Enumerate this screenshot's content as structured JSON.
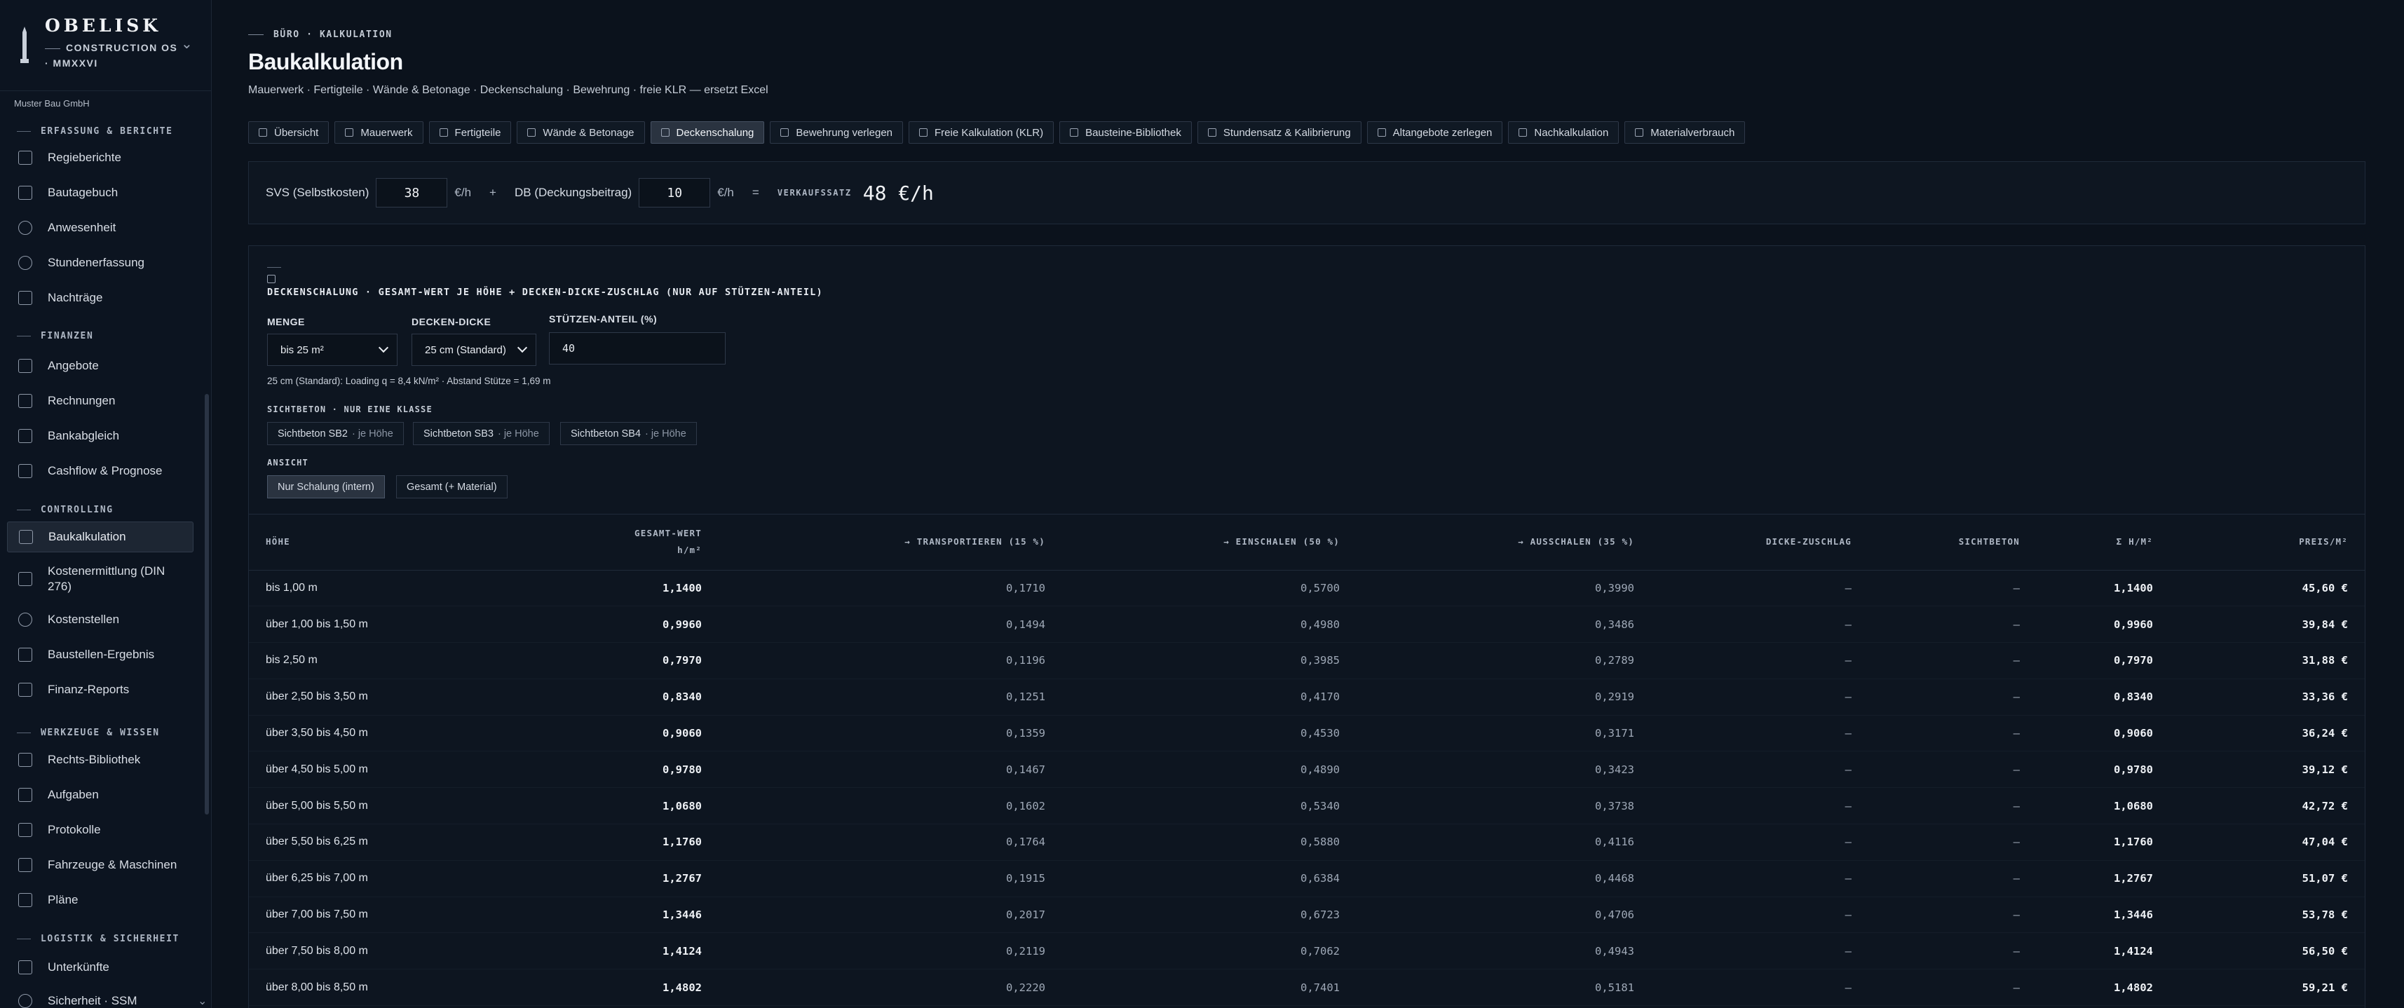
{
  "sidebar": {
    "brand": {
      "name": "OBELISK",
      "line1": "CONSTRUCTION OS",
      "line2": "· MMXXVI"
    },
    "company": "Muster Bau GmbH",
    "groups": {
      "erfassung": "ERFASSUNG & BERICHTE",
      "finanzen": "FINANZEN",
      "controlling": "CONTROLLING",
      "werkzeuge": "WERKZEUGE & WISSEN",
      "logistik": "LOGISTIK & SICHERHEIT"
    },
    "items": {
      "regieberichte": "Regieberichte",
      "bautagebuch": "Bautagebuch",
      "anwesenheit": "Anwesenheit",
      "stundenerfassung": "Stundenerfassung",
      "nachtraege": "Nachträge",
      "angebote": "Angebote",
      "rechnungen": "Rechnungen",
      "bankabgleich": "Bankabgleich",
      "cashflow": "Cashflow & Prognose",
      "baukalkulation": "Baukalkulation",
      "kostenermittlung_1": "Kostenermittlung (DIN",
      "kostenermittlung_2": "276)",
      "kostenstellen": "Kostenstellen",
      "baustellen_ergebnis": "Baustellen-Ergebnis",
      "finanz_reports": "Finanz-Reports",
      "rechts_bibliothek": "Rechts-Bibliothek",
      "aufgaben": "Aufgaben",
      "protokolle": "Protokolle",
      "fahrzeuge": "Fahrzeuge & Maschinen",
      "plaene": "Pläne",
      "unterkuenfte": "Unterkünfte",
      "sicherheit": "Sicherheit · SSM"
    }
  },
  "header": {
    "breadcrumb": "BÜRO · KALKULATION",
    "title": "Baukalkulation",
    "subtitle": "Mauerwerk · Fertigteile · Wände & Betonage · Deckenschalung · Bewehrung · freie KLR — ersetzt Excel"
  },
  "tabs": [
    {
      "label": "Übersicht",
      "icon": "overview-icon"
    },
    {
      "label": "Mauerwerk",
      "icon": "brick-icon"
    },
    {
      "label": "Fertigteile",
      "icon": "precast-icon"
    },
    {
      "label": "Wände & Betonage",
      "icon": "wall-icon"
    },
    {
      "label": "Deckenschalung",
      "icon": "slab-icon",
      "active": true
    },
    {
      "label": "Bewehrung verlegen",
      "icon": "rebar-icon"
    },
    {
      "label": "Freie Kalkulation (KLR)",
      "icon": "sheet-icon"
    },
    {
      "label": "Bausteine-Bibliothek",
      "icon": "library-icon"
    },
    {
      "label": "Stundensatz & Kalibrierung",
      "icon": "calibrate-icon"
    },
    {
      "label": "Altangebote zerlegen",
      "icon": "split-icon"
    },
    {
      "label": "Nachkalkulation",
      "icon": "postcalc-icon"
    },
    {
      "label": "Materialverbrauch",
      "icon": "material-icon"
    }
  ],
  "rates": {
    "svs_label": "SVS (Selbstkosten)",
    "svs_value": "38",
    "unit": "€/h",
    "plus": "+",
    "db_label": "DB (Deckungsbeitrag)",
    "db_value": "10",
    "equals": "=",
    "vk_label": "VERKAUFSSATZ",
    "vk_value": "48 €/h"
  },
  "calc": {
    "title": "DECKENSCHALUNG · GESAMT-WERT JE HÖHE + DECKEN-DICKE-ZUSCHLAG (NUR AUF STÜTZEN-ANTEIL)",
    "menge_label": "MENGE",
    "menge_value": "bis 25 m²",
    "dicke_label": "DECKEN-DICKE",
    "dicke_value": "25 cm (Standard)",
    "stuetzen_label": "STÜTZEN-ANTEIL (%)",
    "stuetzen_value": "40",
    "hint": "25 cm (Standard): Loading q = 8,4 kN/m² · Abstand Stütze = 1,69 m",
    "sichtbeton_label": "SICHTBETON · NUR EINE KLASSE",
    "sichtbeton_options": [
      {
        "label": "Sichtbeton SB2",
        "suffix": "· je Höhe"
      },
      {
        "label": "Sichtbeton SB3",
        "suffix": "· je Höhe"
      },
      {
        "label": "Sichtbeton SB4",
        "suffix": "· je Höhe"
      }
    ],
    "ansicht_label": "ANSICHT",
    "ansicht_options": [
      "Nur Schalung (intern)",
      "Gesamt (+ Material)"
    ]
  },
  "table": {
    "headers": {
      "hoehe": "HÖHE",
      "gesamt_1": "GESAMT-WERT",
      "gesamt_2": "h/m²",
      "transport": "→ TRANSPORTIEREN (15 %)",
      "einschalen": "→ EINSCHALEN (50 %)",
      "ausschalen": "→ AUSSCHALEN (35 %)",
      "dicke": "DICKE-ZUSCHLAG",
      "sichtbeton": "SICHTBETON",
      "summe": "Σ H/M²",
      "preis": "PREIS/M²"
    },
    "rows": [
      [
        "bis 1,00 m",
        "1,1400",
        "0,1710",
        "0,5700",
        "0,3990",
        "—",
        "—",
        "1,1400",
        "45,60 €"
      ],
      [
        "über 1,00 bis 1,50 m",
        "0,9960",
        "0,1494",
        "0,4980",
        "0,3486",
        "—",
        "—",
        "0,9960",
        "39,84 €"
      ],
      [
        "bis 2,50 m",
        "0,7970",
        "0,1196",
        "0,3985",
        "0,2789",
        "—",
        "—",
        "0,7970",
        "31,88 €"
      ],
      [
        "über 2,50 bis 3,50 m",
        "0,8340",
        "0,1251",
        "0,4170",
        "0,2919",
        "—",
        "—",
        "0,8340",
        "33,36 €"
      ],
      [
        "über 3,50 bis 4,50 m",
        "0,9060",
        "0,1359",
        "0,4530",
        "0,3171",
        "—",
        "—",
        "0,9060",
        "36,24 €"
      ],
      [
        "über 4,50 bis 5,00 m",
        "0,9780",
        "0,1467",
        "0,4890",
        "0,3423",
        "—",
        "—",
        "0,9780",
        "39,12 €"
      ],
      [
        "über 5,00 bis 5,50 m",
        "1,0680",
        "0,1602",
        "0,5340",
        "0,3738",
        "—",
        "—",
        "1,0680",
        "42,72 €"
      ],
      [
        "über 5,50 bis 6,25 m",
        "1,1760",
        "0,1764",
        "0,5880",
        "0,4116",
        "—",
        "—",
        "1,1760",
        "47,04 €"
      ],
      [
        "über 6,25 bis 7,00 m",
        "1,2767",
        "0,1915",
        "0,6384",
        "0,4468",
        "—",
        "—",
        "1,2767",
        "51,07 €"
      ],
      [
        "über 7,00 bis 7,50 m",
        "1,3446",
        "0,2017",
        "0,6723",
        "0,4706",
        "—",
        "—",
        "1,3446",
        "53,78 €"
      ],
      [
        "über 7,50 bis 8,00 m",
        "1,4124",
        "0,2119",
        "0,7062",
        "0,4943",
        "—",
        "—",
        "1,4124",
        "56,50 €"
      ],
      [
        "über 8,00 bis 8,50 m",
        "1,4802",
        "0,2220",
        "0,7401",
        "0,5181",
        "—",
        "—",
        "1,4802",
        "59,21 €"
      ]
    ]
  }
}
